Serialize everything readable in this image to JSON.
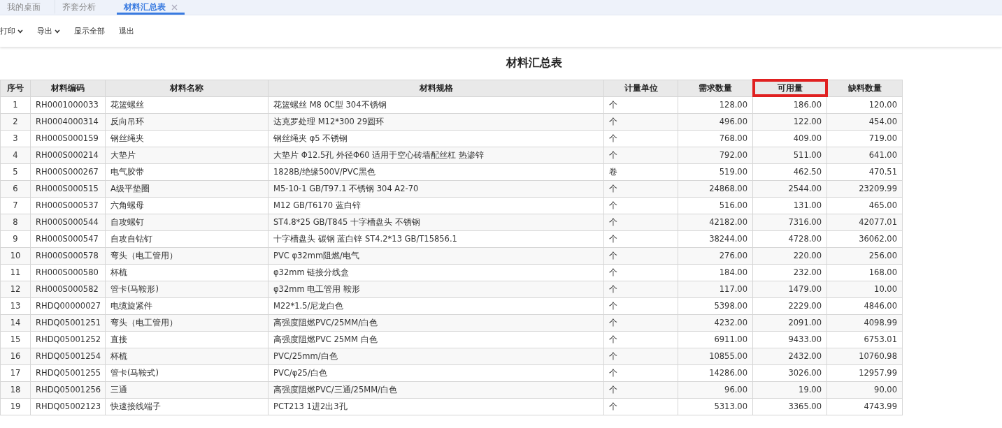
{
  "tabs": [
    {
      "label": "我的桌面",
      "selected": false,
      "closable": false
    },
    {
      "label": "齐套分析",
      "selected": false,
      "closable": false
    },
    {
      "label": "材料汇总表",
      "selected": true,
      "closable": true
    }
  ],
  "toolbar": [
    {
      "label": "打印",
      "dropdown": true
    },
    {
      "label": "导出",
      "dropdown": true
    },
    {
      "label": "显示全部",
      "dropdown": false
    },
    {
      "label": "退出",
      "dropdown": false
    }
  ],
  "report": {
    "title": "材料汇总表",
    "columns": [
      {
        "label": "序号",
        "highlighted": false
      },
      {
        "label": "材料编码",
        "highlighted": false
      },
      {
        "label": "材料名称",
        "highlighted": false
      },
      {
        "label": "材料规格",
        "highlighted": false
      },
      {
        "label": "计量单位",
        "highlighted": false
      },
      {
        "label": "需求数量",
        "highlighted": false
      },
      {
        "label": "可用量",
        "highlighted": true
      },
      {
        "label": "缺料数量",
        "highlighted": false
      }
    ],
    "rows": [
      [
        "1",
        "RH0001000033",
        "花篮螺丝",
        "花篮螺丝 M8 0C型 304不锈钢",
        "个",
        "128.00",
        "186.00",
        "120.00"
      ],
      [
        "2",
        "RH0004000314",
        "反向吊环",
        "达克罗处理 M12*300 29圆环",
        "个",
        "496.00",
        "122.00",
        "454.00"
      ],
      [
        "3",
        "RH000S000159",
        "钢丝绳夹",
        "钢丝绳夹 φ5 不锈钢",
        "个",
        "768.00",
        "409.00",
        "719.00"
      ],
      [
        "4",
        "RH000S000214",
        "大垫片",
        "大垫片 Φ12.5孔 外径Φ60 适用于空心砖墙配丝杠 热渗锌",
        "个",
        "792.00",
        "511.00",
        "641.00"
      ],
      [
        "5",
        "RH000S000267",
        "电气胶带",
        "1828B/绝缘500V/PVC黑色",
        "卷",
        "519.00",
        "462.50",
        "470.51"
      ],
      [
        "6",
        "RH000S000515",
        "A级平垫圈",
        "M5-10-1 GB/T97.1 不锈钢 304 A2-70",
        "个",
        "24868.00",
        "2544.00",
        "23209.99"
      ],
      [
        "7",
        "RH000S000537",
        "六角螺母",
        "M12 GB/T6170 蓝白锌",
        "个",
        "516.00",
        "131.00",
        "465.00"
      ],
      [
        "8",
        "RH000S000544",
        "自攻螺钉",
        "ST4.8*25 GB/T845 十字槽盘头 不锈钢",
        "个",
        "42182.00",
        "7316.00",
        "42077.01"
      ],
      [
        "9",
        "RH000S000547",
        "自攻自钻钉",
        "十字槽盘头 碳钢 蓝白锌 ST4.2*13 GB/T15856.1",
        "个",
        "38244.00",
        "4728.00",
        "36062.00"
      ],
      [
        "10",
        "RH000S000578",
        "弯头（电工管用）",
        "PVC φ32mm阻燃/电气",
        "个",
        "276.00",
        "220.00",
        "256.00"
      ],
      [
        "11",
        "RH000S000580",
        "杯梳",
        "φ32mm 链接分线盒",
        "个",
        "184.00",
        "232.00",
        "168.00"
      ],
      [
        "12",
        "RH000S000582",
        "管卡(马鞍形)",
        "φ32mm 电工管用 鞍形",
        "个",
        "117.00",
        "1479.00",
        "10.00"
      ],
      [
        "13",
        "RHDQ00000027",
        "电缆旋紧件",
        "M22*1.5/尼龙白色",
        "个",
        "5398.00",
        "2229.00",
        "4846.00"
      ],
      [
        "14",
        "RHDQ05001251",
        "弯头（电工管用）",
        "高强度阻燃PVC/25MM/白色",
        "个",
        "4232.00",
        "2091.00",
        "4098.99"
      ],
      [
        "15",
        "RHDQ05001252",
        "直接",
        "高强度阻燃PVC 25MM 白色",
        "个",
        "6911.00",
        "9433.00",
        "6753.01"
      ],
      [
        "16",
        "RHDQ05001254",
        "杯梳",
        "PVC/25mm/白色",
        "个",
        "10855.00",
        "2432.00",
        "10760.98"
      ],
      [
        "17",
        "RHDQ05001255",
        "管卡(马鞍式)",
        "PVC/φ25/白色",
        "个",
        "14286.00",
        "3026.00",
        "12957.99"
      ],
      [
        "18",
        "RHDQ05001256",
        "三通",
        "高强度阻燃PVC/三通/25MM/白色",
        "个",
        "96.00",
        "19.00",
        "90.00"
      ],
      [
        "19",
        "RHDQ05002123",
        "快速接线端子",
        "PCT213 1进2出3孔",
        "个",
        "5313.00",
        "3365.00",
        "4743.99"
      ]
    ]
  }
}
